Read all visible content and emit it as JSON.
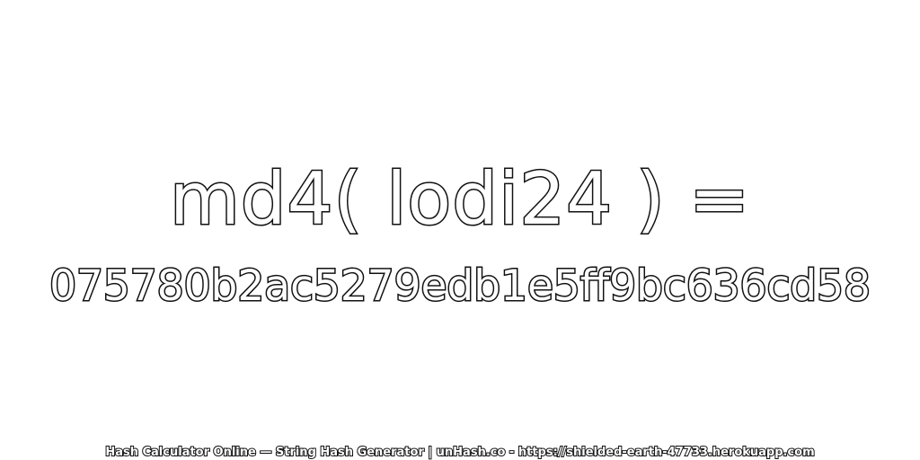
{
  "expression": "md4( lodi24 ) =",
  "hash_value": "075780b2ac5279edb1e5ff9bc636cd58",
  "footer": "Hash Calculator Online — String Hash Generator | unHash.co - https://shielded-earth-47733.herokuapp.com",
  "colors": {
    "background": "#ffffff",
    "text_fill": "#ffffff",
    "text_outline": "#111111"
  }
}
